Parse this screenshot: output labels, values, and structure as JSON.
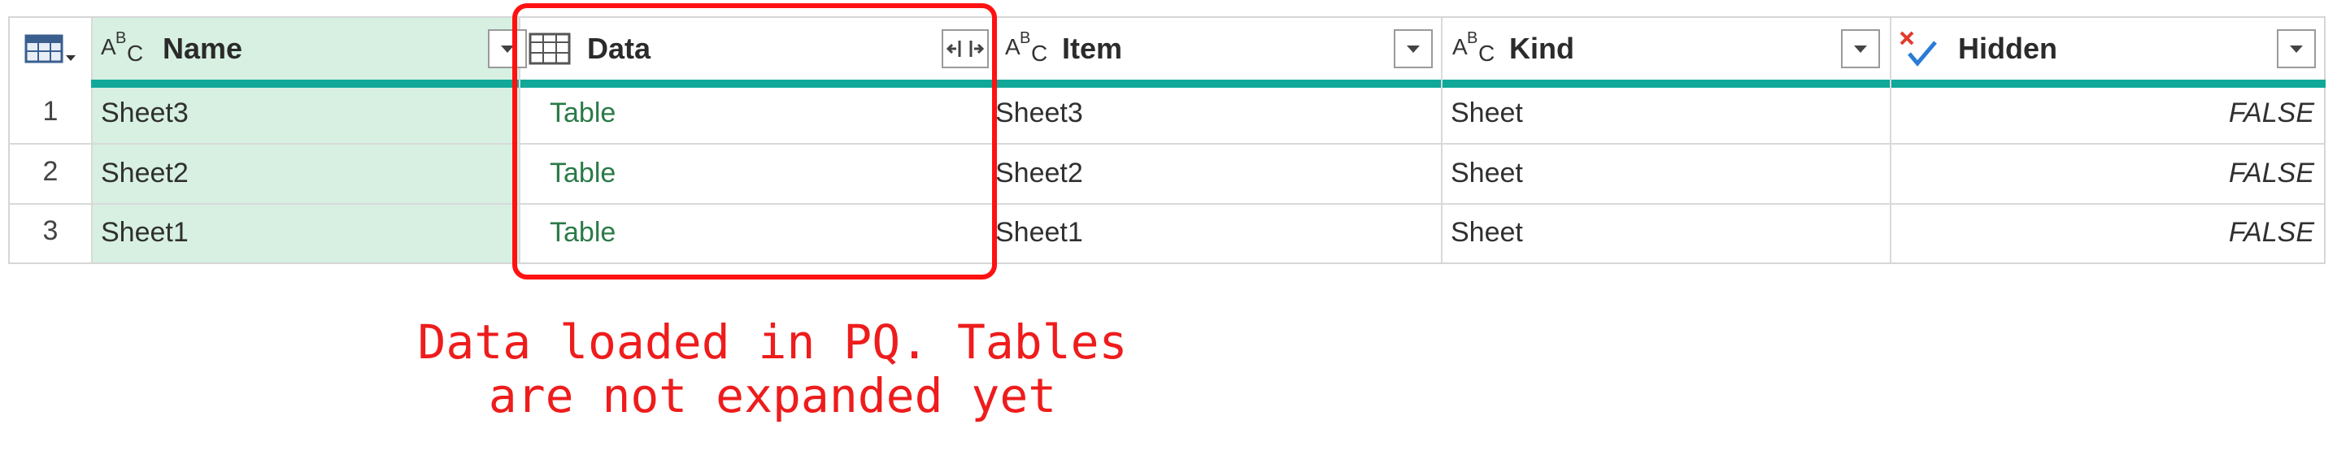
{
  "columns": [
    {
      "key": "name",
      "label": "Name",
      "type_icon": "abc-text-icon"
    },
    {
      "key": "data",
      "label": "Data",
      "type_icon": "table-icon"
    },
    {
      "key": "item",
      "label": "Item",
      "type_icon": "abc-text-icon"
    },
    {
      "key": "kind",
      "label": "Kind",
      "type_icon": "abc-text-icon"
    },
    {
      "key": "hidden",
      "label": "Hidden",
      "type_icon": "true-false-icon"
    }
  ],
  "type_glyph": {
    "a": "A",
    "b": "B",
    "c": "C"
  },
  "rows": [
    {
      "index": "1",
      "name": "Sheet3",
      "data": "Table",
      "item": "Sheet3",
      "kind": "Sheet",
      "hidden": "FALSE"
    },
    {
      "index": "2",
      "name": "Sheet2",
      "data": "Table",
      "item": "Sheet2",
      "kind": "Sheet",
      "hidden": "FALSE"
    },
    {
      "index": "3",
      "name": "Sheet1",
      "data": "Table",
      "item": "Sheet1",
      "kind": "Sheet",
      "hidden": "FALSE"
    }
  ],
  "annotation": {
    "line1": "Data loaded in PQ. Tables",
    "line2": "are not expanded yet"
  },
  "colors": {
    "selected_column_bg": "#d7f0e2",
    "quality_bar": "#10a899",
    "table_link_text": "#2a7a47",
    "highlight": "#ff1111",
    "annotation_text": "#ee1c1c"
  }
}
